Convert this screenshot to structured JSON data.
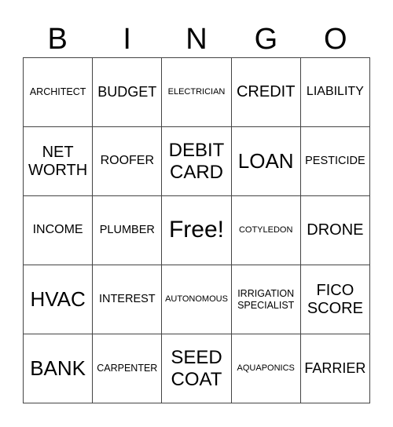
{
  "header": {
    "letters": [
      "B",
      "I",
      "N",
      "G",
      "O"
    ]
  },
  "cells": [
    "ARCHITECT",
    "BUDGET",
    "ELECTRICIAN",
    "CREDIT",
    "LIABILITY",
    "NET WORTH",
    "ROOFER",
    "DEBIT CARD",
    "LOAN",
    "PESTICIDE",
    "INCOME",
    "PLUMBER",
    "Free!",
    "COTYLEDON",
    "DRONE",
    "HVAC",
    "INTEREST",
    "AUTONOMOUS",
    "IRRIGATION SPECIALIST",
    "FICO SCORE",
    "BANK",
    "CARPENTER",
    "SEED COAT",
    "AQUAPONICS",
    "FARRIER"
  ]
}
